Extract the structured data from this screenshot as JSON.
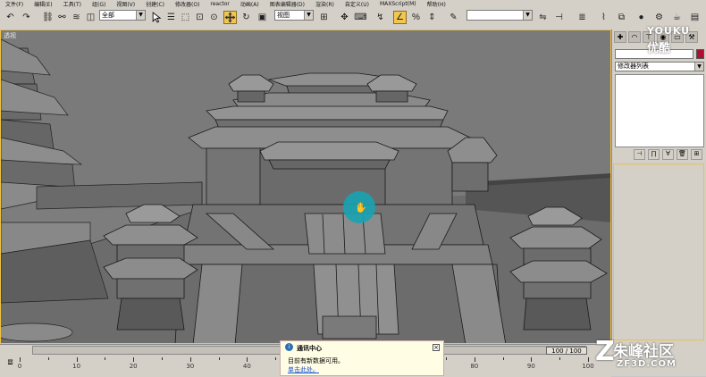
{
  "menubar": {
    "items": [
      "文件(F)",
      "编辑(E)",
      "工具(T)",
      "组(G)",
      "视图(V)",
      "创建(C)",
      "修改器(O)",
      "reactor",
      "动画(A)",
      "图表编辑器(D)",
      "渲染(R)",
      "自定义(U)",
      "MAXScript(M)",
      "帮助(H)"
    ]
  },
  "toolbar": {
    "selection_filter": "全部",
    "ref_coord": "视图",
    "named_selection": ""
  },
  "viewport": {
    "label": "透视"
  },
  "command_panel": {
    "modifier_list": "修改器列表"
  },
  "timeline": {
    "frame_counter": "100 / 100",
    "ticks": [
      0,
      10,
      20,
      30,
      40,
      50,
      60,
      70,
      80,
      90,
      100
    ]
  },
  "notification": {
    "title": "通讯中心",
    "message": "目前有新数据可用。",
    "link": "单击此处。"
  },
  "watermarks": {
    "youku_top": "YOUKU",
    "youku_bottom": "优酷",
    "zf_cn": "朱峰社区",
    "zf_en": "ZF3D.COM"
  },
  "colors": {
    "ui_gray": "#d4d0c8",
    "viewport_bg": "#7a7a7a",
    "active_border": "#f0c040",
    "cursor": "#1aa0b0"
  }
}
